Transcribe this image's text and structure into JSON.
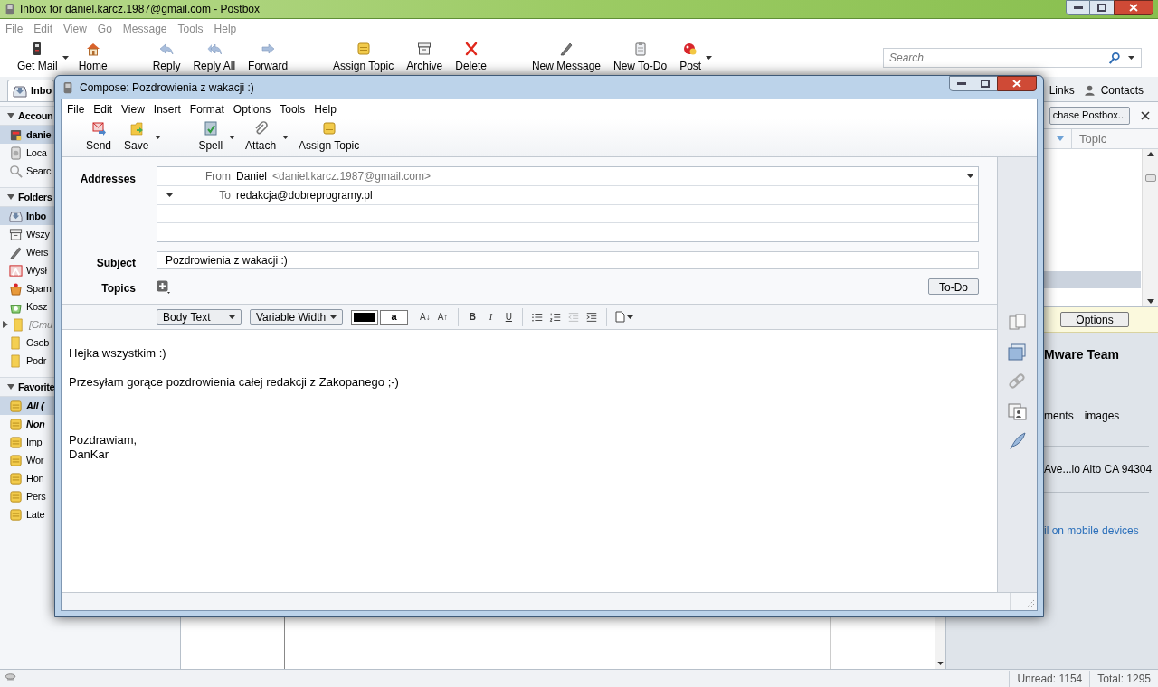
{
  "main_window": {
    "title": "Inbox for daniel.karcz.1987@gmail.com - Postbox"
  },
  "menu": [
    "File",
    "Edit",
    "View",
    "Go",
    "Message",
    "Tools",
    "Help"
  ],
  "toolbar": [
    [
      {
        "label": "Get Mail",
        "kind": "getmail",
        "dropdown": true
      },
      {
        "label": "Home",
        "kind": "home",
        "dropdown": false
      }
    ],
    [
      {
        "label": "Reply",
        "kind": "reply",
        "dropdown": false
      },
      {
        "label": "Reply All",
        "kind": "replyall",
        "dropdown": false
      },
      {
        "label": "Forward",
        "kind": "forward",
        "dropdown": false
      }
    ],
    [
      {
        "label": "Assign Topic",
        "kind": "topic",
        "dropdown": false
      },
      {
        "label": "Archive",
        "kind": "archive",
        "dropdown": false
      },
      {
        "label": "Delete",
        "kind": "delete",
        "dropdown": false
      }
    ],
    [
      {
        "label": "New Message",
        "kind": "compose",
        "dropdown": false
      },
      {
        "label": "New To-Do",
        "kind": "todo",
        "dropdown": false
      },
      {
        "label": "Post",
        "kind": "post",
        "dropdown": true
      }
    ]
  ],
  "search": {
    "placeholder": "Search"
  },
  "tabs": [
    {
      "label": "Inbo",
      "selected": true
    }
  ],
  "tab_links": [
    {
      "label": "Links",
      "kind": "plain"
    },
    {
      "label": "Contacts",
      "kind": "person"
    }
  ],
  "sidebar": [
    {
      "label": "Accoun",
      "expanded": true,
      "items": [
        {
          "label": "danie",
          "kind": "account",
          "selected": true
        },
        {
          "label": "Loca",
          "kind": "local",
          "selected": false
        },
        {
          "label": "Searc",
          "kind": "search",
          "selected": false
        }
      ]
    },
    {
      "label": "Folders",
      "expanded": true,
      "items": [
        {
          "label": "Inbo",
          "kind": "inbox",
          "selected": true
        },
        {
          "label": "Wszy",
          "kind": "archive",
          "selected": false
        },
        {
          "label": "Wers",
          "kind": "drafts",
          "selected": false
        },
        {
          "label": "Wysł",
          "kind": "sent",
          "selected": false
        },
        {
          "label": "Spam",
          "kind": "spam",
          "selected": false
        },
        {
          "label": "Kosz",
          "kind": "trash",
          "selected": false
        },
        {
          "label": "[Gmu",
          "kind": "group",
          "selected": false
        },
        {
          "label": "Osob",
          "kind": "folder",
          "selected": false
        },
        {
          "label": "Podr",
          "kind": "folder",
          "selected": false
        }
      ]
    },
    {
      "label": "Favorite",
      "expanded": true,
      "items": [
        {
          "label": "All (",
          "kind": "smarttopic",
          "selected": true
        },
        {
          "label": "Non",
          "kind": "smarttopic",
          "selected": false
        },
        {
          "label": "Imp",
          "kind": "topic",
          "selected": false
        },
        {
          "label": "Wor",
          "kind": "topic",
          "selected": false
        },
        {
          "label": "Hon",
          "kind": "topic",
          "selected": false
        },
        {
          "label": "Pers",
          "kind": "topic",
          "selected": false
        },
        {
          "label": "Late",
          "kind": "topic",
          "selected": false
        }
      ]
    }
  ],
  "notification": {
    "button": "chase Postbox..."
  },
  "message_list": {
    "columns": [
      {
        "label": "Topic"
      }
    ],
    "rows": [
      {
        "selected": false
      },
      {
        "selected": false
      },
      {
        "selected": false
      },
      {
        "selected": true
      }
    ]
  },
  "preview": {
    "options_button": "Options",
    "sender": "Mware Team",
    "attachments": [
      "ments",
      "images"
    ],
    "address": "Ave...lo Alto CA 94304",
    "link": "il on mobile devices"
  },
  "status_bar": {
    "unread": "Unread: 1154",
    "total": "Total: 1295"
  },
  "compose": {
    "title": "Compose: Pozdrowienia z wakacji :)",
    "menu": [
      "File",
      "Edit",
      "View",
      "Insert",
      "Format",
      "Options",
      "Tools",
      "Help"
    ],
    "toolbar": [
      [
        {
          "label": "Send",
          "kind": "send",
          "dropdown": false
        },
        {
          "label": "Save",
          "kind": "save",
          "dropdown": true
        }
      ],
      [
        {
          "label": "Spell",
          "kind": "spell",
          "dropdown": true
        },
        {
          "label": "Attach",
          "kind": "attach",
          "dropdown": true
        },
        {
          "label": "Assign Topic",
          "kind": "topic",
          "dropdown": false
        }
      ]
    ],
    "addresses_label": "Addresses",
    "from": {
      "label": "From",
      "name": "Daniel",
      "address": "<daniel.karcz.1987@gmail.com>"
    },
    "recipients": [
      {
        "label": "To",
        "value": "redakcja@dobreprogramy.pl"
      }
    ],
    "subject_label": "Subject",
    "subject": "Pozdrowienia z wakacji :)",
    "topics_label": "Topics",
    "todo_button": "To-Do",
    "paragraph_style": "Body Text",
    "font": "Variable Width",
    "background_sample": "a",
    "size_buttons": [
      "A↓",
      "A↑"
    ],
    "style_buttons": [
      "B",
      "I",
      "U"
    ],
    "format_icons": [
      {
        "kind": "bullets",
        "disabled": false
      },
      {
        "kind": "numbers",
        "disabled": false
      },
      {
        "kind": "outdent",
        "disabled": true
      },
      {
        "kind": "indent",
        "disabled": false
      }
    ],
    "body": [
      [
        "Hejka wszystkim :)"
      ],
      [
        "Przesyłam gorące pozdrowienia całej redakcji z Zakopanego ;-)"
      ],
      [
        "Pozdrawiam,",
        "DanKar"
      ]
    ]
  }
}
